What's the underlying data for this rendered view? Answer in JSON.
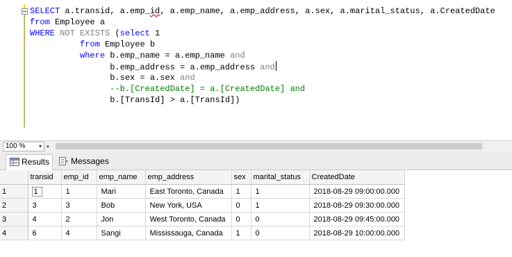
{
  "editor": {
    "lines": [
      [
        {
          "t": "SELECT",
          "c": "kw"
        },
        {
          "t": " a.transid, a.emp_id, a.emp_name, a.emp_address, a.sex, a.marital_status, a.CreatedDate",
          "c": ""
        }
      ],
      [
        {
          "t": "from",
          "c": "kw"
        },
        {
          "t": " Employee a",
          "c": ""
        }
      ],
      [
        {
          "t": "WHERE",
          "c": "kw"
        },
        {
          "t": " ",
          "c": ""
        },
        {
          "t": "NOT EXISTS",
          "c": "gr"
        },
        {
          "t": " (",
          "c": ""
        },
        {
          "t": "select",
          "c": "kw"
        },
        {
          "t": " 1",
          "c": ""
        }
      ],
      [
        {
          "t": "          ",
          "c": ""
        },
        {
          "t": "from",
          "c": "kw"
        },
        {
          "t": " Employee b",
          "c": ""
        }
      ],
      [
        {
          "t": "          ",
          "c": ""
        },
        {
          "t": "where",
          "c": "kw"
        },
        {
          "t": " b.emp_name = a.emp_name ",
          "c": ""
        },
        {
          "t": "and",
          "c": "gr"
        }
      ],
      [
        {
          "t": "                ",
          "c": ""
        },
        {
          "t": "b.emp_address = a.emp_address ",
          "c": ""
        },
        {
          "t": "and",
          "c": "gr"
        }
      ],
      [
        {
          "t": "                ",
          "c": ""
        },
        {
          "t": "b.sex = a.sex ",
          "c": ""
        },
        {
          "t": "and",
          "c": "gr"
        }
      ],
      [
        {
          "t": "                ",
          "c": ""
        },
        {
          "t": "--b.[CreatedDate] = a.[CreatedDate] and",
          "c": "cm"
        }
      ],
      [
        {
          "t": "                ",
          "c": ""
        },
        {
          "t": "b.[TransId] > a.[TransId])",
          "c": ""
        }
      ]
    ]
  },
  "zoom": {
    "value": "100 %",
    "arrow": "▾",
    "scroll_left": "◂"
  },
  "tabs": [
    {
      "label": "Results"
    },
    {
      "label": "Messages"
    }
  ],
  "grid": {
    "columns": [
      "",
      "transid",
      "emp_id",
      "emp_name",
      "emp_address",
      "sex",
      "marital_status",
      "CreatedDate"
    ],
    "rows": [
      [
        "1",
        "1",
        "1",
        "Mari",
        "East Toronto, Canada",
        "1",
        "1",
        "2018-08-29 09:00:00.000"
      ],
      [
        "2",
        "3",
        "3",
        "Bob",
        "New York, USA",
        "0",
        "1",
        "2018-08-29 09:30:00.000"
      ],
      [
        "3",
        "4",
        "2",
        "Jon",
        "West Toronto, Canada",
        "0",
        "0",
        "2018-08-29 09:45:00.000"
      ],
      [
        "4",
        "6",
        "4",
        "Sangi",
        "Mississauga, Canada",
        "1",
        "0",
        "2018-08-29 10:00:00.000"
      ]
    ]
  }
}
